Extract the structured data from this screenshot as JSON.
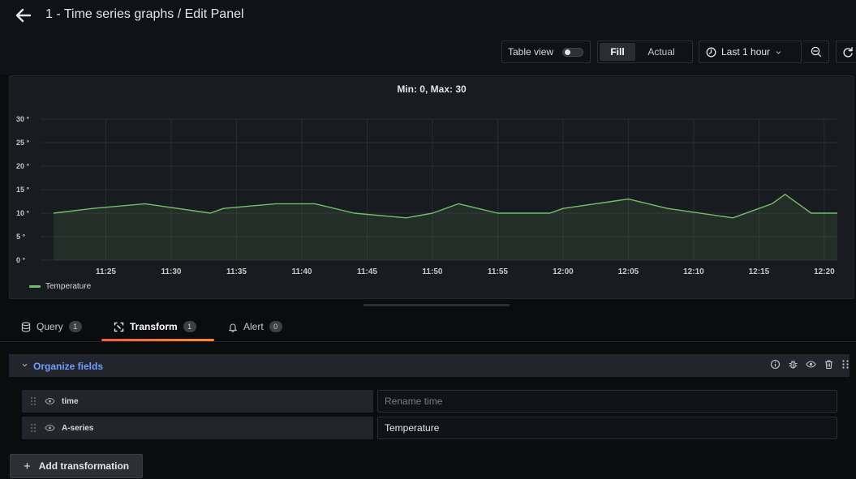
{
  "header": {
    "title": "1 - Time series graphs / Edit Panel"
  },
  "toolbar": {
    "table_view_label": "Table view",
    "table_view_on": false,
    "fill_label": "Fill",
    "actual_label": "Actual",
    "time_range_label": "Last 1 hour"
  },
  "panel": {
    "title": "Min: 0, Max: 30",
    "legend_label": "Temperature"
  },
  "chart_data": {
    "type": "area",
    "title": "Min: 0, Max: 30",
    "xlabel": "",
    "ylabel": "",
    "y_ticks": [
      "0 °",
      "5 °",
      "10 °",
      "15 °",
      "20 °",
      "25 °",
      "30 °"
    ],
    "x_ticks": [
      "11:25",
      "11:30",
      "11:35",
      "11:40",
      "11:45",
      "11:50",
      "11:55",
      "12:00",
      "12:05",
      "12:10",
      "12:15",
      "12:20"
    ],
    "ylim": [
      0,
      30
    ],
    "grid": true,
    "legend": "bottom-left",
    "color": "#73bf69",
    "series": [
      {
        "name": "Temperature",
        "x": [
          "11:21",
          "11:24",
          "11:28",
          "11:33",
          "11:34",
          "11:38",
          "11:41",
          "11:44",
          "11:48",
          "11:50",
          "11:52",
          "11:55",
          "11:59",
          "12:00",
          "12:05",
          "12:08",
          "12:13",
          "12:16",
          "12:17",
          "12:19",
          "12:21"
        ],
        "values": [
          10,
          11,
          12,
          10,
          11,
          12,
          12,
          10,
          9,
          10,
          12,
          10,
          10,
          11,
          13,
          11,
          9,
          12,
          14,
          10,
          10
        ]
      }
    ]
  },
  "tabs": [
    {
      "label": "Query",
      "count": "1"
    },
    {
      "label": "Transform",
      "count": "1"
    },
    {
      "label": "Alert",
      "count": "0"
    }
  ],
  "transformation": {
    "title": "Organize fields",
    "fields": [
      {
        "name": "time",
        "value": "",
        "placeholder": "Rename time"
      },
      {
        "name": "A-series",
        "value": "Temperature",
        "placeholder": ""
      }
    ]
  },
  "add_transformation_label": "Add transformation"
}
